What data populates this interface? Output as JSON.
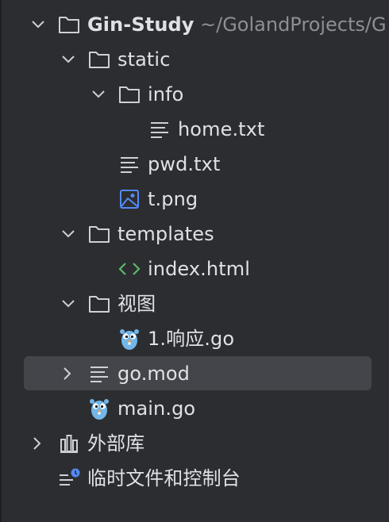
{
  "tree": {
    "root": {
      "label": "Gin-Study",
      "path": "~/GolandProjects/G",
      "icon": "folder-icon",
      "expanded": true
    },
    "static": {
      "label": "static",
      "icon": "folder-icon",
      "expanded": true
    },
    "info": {
      "label": "info",
      "icon": "folder-icon",
      "expanded": true
    },
    "home_txt": {
      "label": "home.txt",
      "icon": "text-file-icon"
    },
    "pwd_txt": {
      "label": "pwd.txt",
      "icon": "text-file-icon"
    },
    "t_png": {
      "label": "t.png",
      "icon": "image-file-icon"
    },
    "templates": {
      "label": "templates",
      "icon": "folder-icon",
      "expanded": true
    },
    "index_html": {
      "label": "index.html",
      "icon": "html-file-icon"
    },
    "views": {
      "label": "视图",
      "icon": "folder-icon",
      "expanded": true
    },
    "response_go": {
      "label": "1.响应.go",
      "icon": "go-gopher-icon"
    },
    "go_mod": {
      "label": "go.mod",
      "icon": "go-mod-icon",
      "expanded": false,
      "selected": true
    },
    "main_go": {
      "label": "main.go",
      "icon": "go-gopher-icon"
    },
    "external_libs": {
      "label": "外部库",
      "icon": "library-icon",
      "expanded": false
    },
    "scratches": {
      "label": "临时文件和控制台",
      "icon": "scratches-icon"
    }
  },
  "colors": {
    "background": "#2b2d30",
    "selection": "#43454a",
    "text": "#dfe1e5",
    "path_text": "#8c8f94",
    "icon_gray": "#ced0d6",
    "image_icon": "#548af7",
    "html_icon": "#5fb865",
    "gopher_blue": "#73b7e8"
  }
}
